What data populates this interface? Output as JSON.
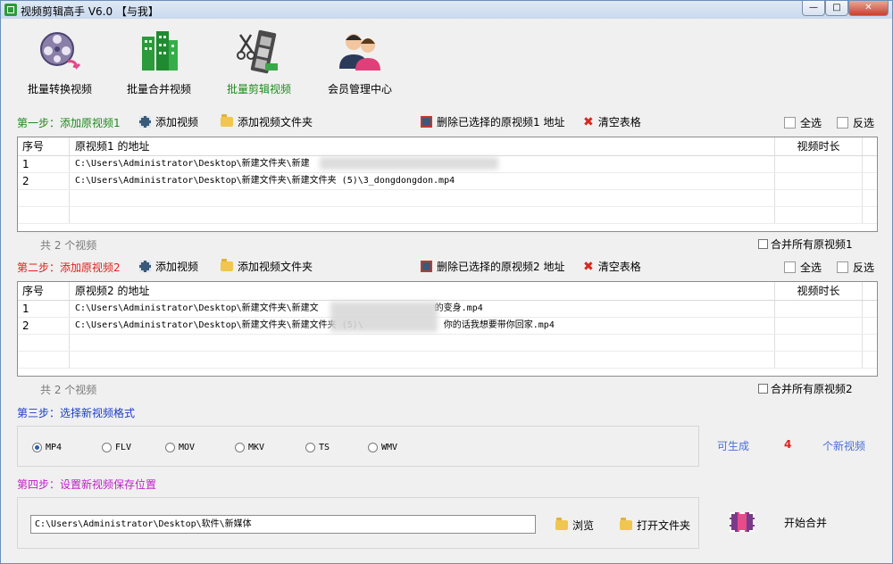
{
  "window": {
    "title": "视频剪辑高手 V6.0 【与我】"
  },
  "toolbar": [
    {
      "label": "批量转换视频",
      "icon": "film-reel-icon"
    },
    {
      "label": "批量合并视频",
      "icon": "buildings-icon"
    },
    {
      "label": "批量剪辑视频",
      "icon": "film-strip-icon"
    },
    {
      "label": "会员管理中心",
      "icon": "users-icon"
    }
  ],
  "step1": {
    "label": "第一步：添加原视频1",
    "add_video": "添加视频",
    "add_folder": "添加视频文件夹",
    "delete_selected": "删除已选择的原视频1 地址",
    "clear_table": "清空表格",
    "select_all": "全选",
    "invert": "反选",
    "columns": [
      "序号",
      "原视频1 的地址",
      "视频时长"
    ],
    "rows": [
      {
        "no": "1",
        "path": "C:\\Users\\Administrator\\Desktop\\新建文件夹\\新建",
        "duration": ""
      },
      {
        "no": "2",
        "path": "C:\\Users\\Administrator\\Desktop\\新建文件夹\\新建文件夹 (5)\\3_dongdongdon.mp4",
        "duration": ""
      }
    ],
    "count": "共 2 个视频",
    "merge_all": "合并所有原视频1"
  },
  "step2": {
    "label": "第二步：添加原视频2",
    "add_video": "添加视频",
    "add_folder": "添加视频文件夹",
    "delete_selected": "删除已选择的原视频2 地址",
    "clear_table": "清空表格",
    "select_all": "全选",
    "invert": "反选",
    "columns": [
      "序号",
      "原视频2 的地址",
      "视频时长"
    ],
    "rows": [
      {
        "no": "1",
        "path": "C:\\Users\\Administrator\\Desktop\\新建文件夹\\新建文",
        "path_tail": "的变身.mp4",
        "duration": ""
      },
      {
        "no": "2",
        "path": "C:\\Users\\Administrator\\Desktop\\新建文件夹\\新建文件夹 (5)\\",
        "path_tail": "你的话我想要带你回家.mp4",
        "duration": ""
      }
    ],
    "count": "共 2 个视频",
    "merge_all": "合并所有原视频2"
  },
  "step3": {
    "label": "第三步：选择新视频格式",
    "formats": [
      "MP4",
      "FLV",
      "MOV",
      "MKV",
      "TS",
      "WMV"
    ],
    "selected": "MP4",
    "can_generate": "可生成",
    "count": "4",
    "unit": "个新视频"
  },
  "step4": {
    "label": "第四步：设置新视频保存位置",
    "path": "C:\\Users\\Administrator\\Desktop\\软件\\新媒体",
    "browse": "浏览",
    "open_folder": "打开文件夹",
    "start_merge": "开始合并"
  },
  "colors": {
    "step1": "#1c8a1c",
    "step2": "#e0201c",
    "step3": "#1c3cc8",
    "step4": "#c020c8",
    "accent_blue": "#4a6fd8",
    "count_red": "#e0201c"
  }
}
